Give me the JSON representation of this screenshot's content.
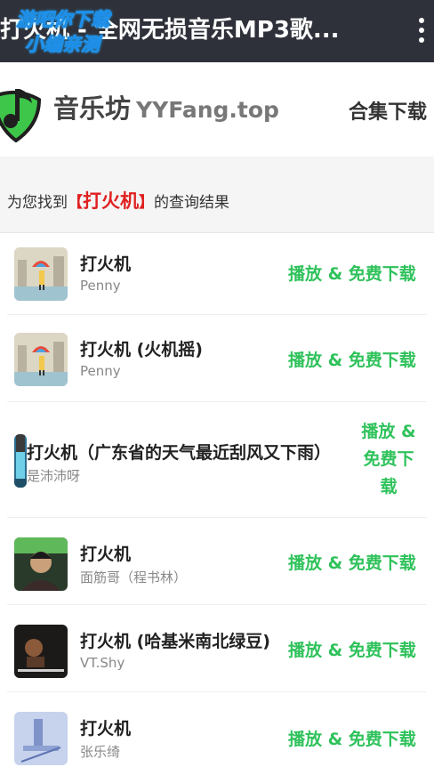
{
  "app_bar": {
    "title": "打火机 - 全网无损音乐MP3歌...",
    "watermark_line1": "游吧你下载",
    "watermark_line2": "小编亲测",
    "menu_icon": "more-vertical-icon"
  },
  "header": {
    "brand_cn": "音乐坊",
    "brand_en": "YYFang.top",
    "collection_link": "合集下载",
    "logo_icon": "music-note-shield-icon",
    "colors": {
      "logo_green": "#3ec64a",
      "logo_dark": "#1f1f1f"
    }
  },
  "result": {
    "prefix": "为您找到",
    "bracket_open": "【",
    "keyword": "打火机",
    "bracket_close": "】",
    "suffix": "的查询结果"
  },
  "songs": [
    {
      "title": "打火机",
      "artist": "Penny",
      "action": "播放 & 免费下载",
      "cover": "rainy-city-cover"
    },
    {
      "title": "打火机 (火机摇)",
      "artist": "Penny",
      "action": "播放 & 免费下载",
      "cover": "rainy-city-cover"
    },
    {
      "title": "打火机（广东省的天气最近刮风又下雨）",
      "artist": "是沛沛呀",
      "action": "播放 & 免费下载",
      "cover": "blue-figure-cover"
    },
    {
      "title": "打火机",
      "artist": "面筋哥（程书林）",
      "action": "播放 & 免费下载",
      "cover": "portrait-cover"
    },
    {
      "title": "打火机 (哈基米南北绿豆)",
      "artist": "VT.Shy",
      "action": "播放 & 免费下载",
      "cover": "dark-photo-cover"
    },
    {
      "title": "打火机",
      "artist": "张乐绮",
      "action": "播放 & 免费下载",
      "cover": "blue-sketch-cover"
    }
  ],
  "colors": {
    "topbar": "#2f313a",
    "accent_red": "#e02020",
    "action_green": "#2fc25b"
  }
}
